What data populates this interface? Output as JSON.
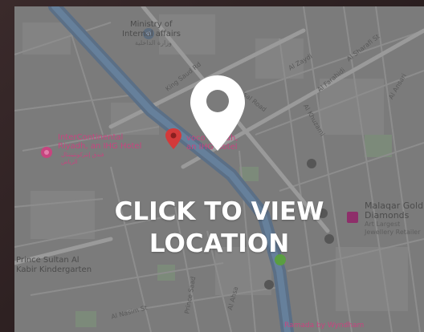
{
  "overlay": {
    "cta_line1": "CLICK TO VIEW",
    "cta_line2": "LOCATION",
    "pin_icon": "location-pin-icon",
    "color": "#ffffff"
  },
  "map": {
    "background": "#7b7b7b",
    "major_road_color": "#56697f",
    "labels": {
      "ministry": "Ministry of",
      "ministry2": "Internal affairs",
      "ministry_ar": "وزارة الداخلية",
      "king_saud": "King Saud Rd",
      "king_faisal": "King Faisal Road",
      "al_zaidi": "Al Zaydi",
      "al_faraheed": "Al Farahidi",
      "mosque_rd": "Al Sharafi St",
      "al_ansari": "Al Ansari",
      "al_khuzami": "Al Khuzami",
      "intercontinental1": "InterContinental",
      "intercontinental2": "Riyadh, an IHG Hotel",
      "intercontinental_ar1": "فندق إنتركونتيننتال",
      "intercontinental_ar2": "الرياض",
      "voco1": "voco Riyadh,",
      "voco2": "an IHG Hotel",
      "malaqar1": "Malaqar Gold",
      "malaqar2": "Diamonds",
      "malaqar3": "Art Largest",
      "malaqar4": "Jewellery Retailer",
      "prince1": "Prince Sultan Al",
      "prince2": "Kabir Kindergarten",
      "ramada": "Ramada by Wyndham",
      "street_a": "Al Nasim St",
      "street_b": "Prince Saad",
      "street_c": "Al Ahsa"
    }
  }
}
